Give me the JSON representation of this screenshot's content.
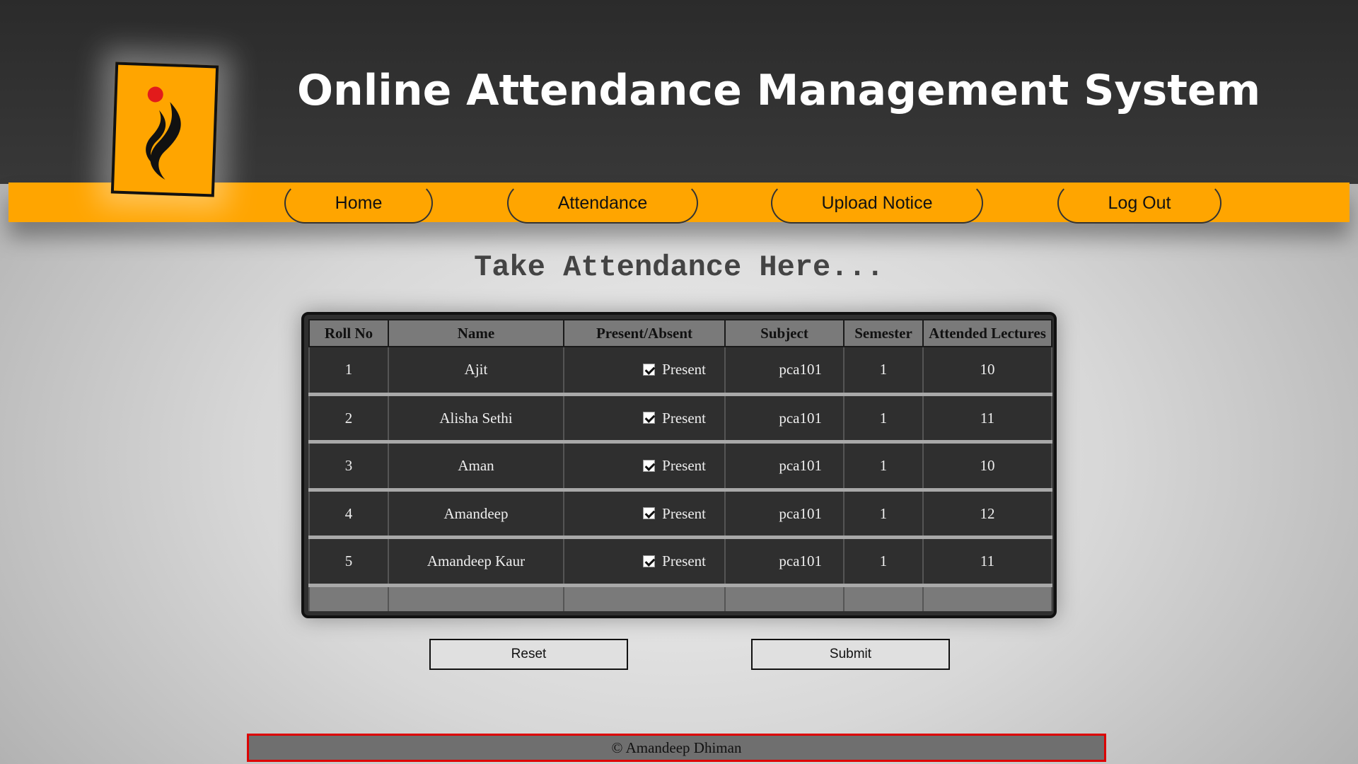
{
  "header": {
    "title": "Online Attendance Management System",
    "logo_icon": "flame-logo-icon",
    "accent_color": "#ffa500"
  },
  "nav": {
    "items": [
      {
        "label": "Home"
      },
      {
        "label": "Attendance"
      },
      {
        "label": "Upload Notice"
      },
      {
        "label": "Log Out"
      }
    ]
  },
  "main": {
    "subtitle": "Take Attendance Here...",
    "table": {
      "columns": [
        "Roll No",
        "Name",
        "Present/Absent",
        "Subject",
        "Semester",
        "Attended Lectures"
      ],
      "rows": [
        {
          "roll": "1",
          "name": "Ajit",
          "status": "Present",
          "checked": true,
          "subject": "pca101",
          "semester": "1",
          "attended": "10"
        },
        {
          "roll": "2",
          "name": "Alisha Sethi",
          "status": "Present",
          "checked": true,
          "subject": "pca101",
          "semester": "1",
          "attended": "11"
        },
        {
          "roll": "3",
          "name": "Aman",
          "status": "Present",
          "checked": true,
          "subject": "pca101",
          "semester": "1",
          "attended": "10"
        },
        {
          "roll": "4",
          "name": "Amandeep",
          "status": "Present",
          "checked": true,
          "subject": "pca101",
          "semester": "1",
          "attended": "12"
        },
        {
          "roll": "5",
          "name": "Amandeep Kaur",
          "status": "Present",
          "checked": true,
          "subject": "pca101",
          "semester": "1",
          "attended": "11"
        }
      ]
    },
    "reset_label": "Reset",
    "submit_label": "Submit"
  },
  "footer": {
    "text": "© Amandeep Dhiman"
  }
}
